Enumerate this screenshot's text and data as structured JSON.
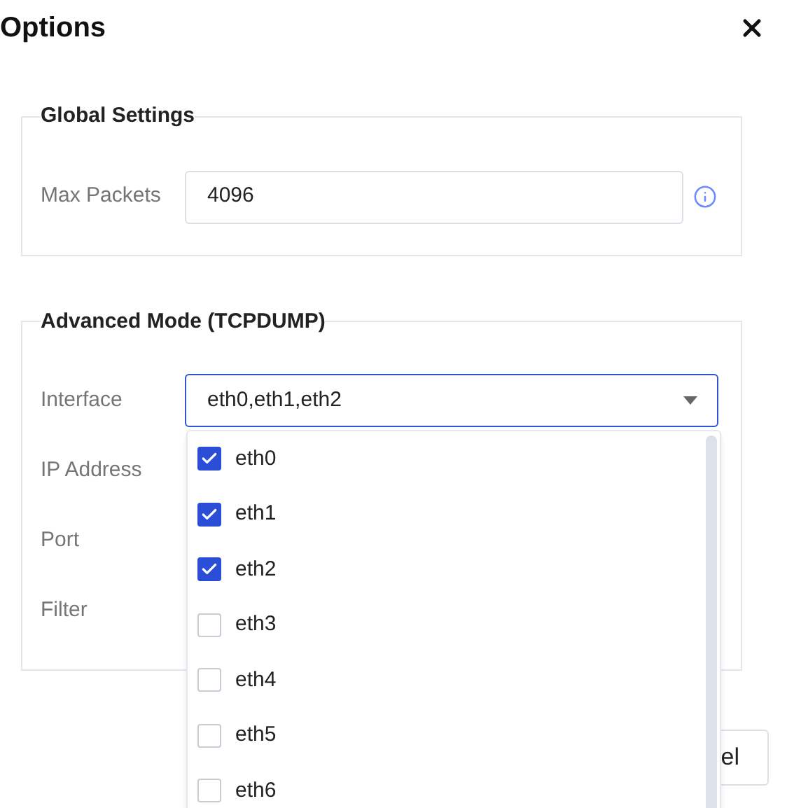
{
  "dialog": {
    "title": "Options"
  },
  "sections": [
    {
      "legend": "Global Settings",
      "fields": [
        {
          "kind": "input",
          "label": "Max Packets",
          "value": "4096",
          "info": true
        }
      ]
    },
    {
      "legend": "Advanced Mode (TCPDUMP)",
      "fields": [
        {
          "kind": "select",
          "label": "Interface",
          "value": "eth0,eth1,eth2",
          "expanded": true,
          "options": [
            {
              "label": "eth0",
              "checked": true
            },
            {
              "label": "eth1",
              "checked": true
            },
            {
              "label": "eth2",
              "checked": true
            },
            {
              "label": "eth3",
              "checked": false
            },
            {
              "label": "eth4",
              "checked": false
            },
            {
              "label": "eth5",
              "checked": false
            },
            {
              "label": "eth6",
              "checked": false
            }
          ]
        },
        {
          "kind": "input",
          "label": "IP Address"
        },
        {
          "kind": "input",
          "label": "Port"
        },
        {
          "kind": "input",
          "label": "Filter"
        }
      ]
    }
  ],
  "footer_button": {
    "label": "el"
  }
}
